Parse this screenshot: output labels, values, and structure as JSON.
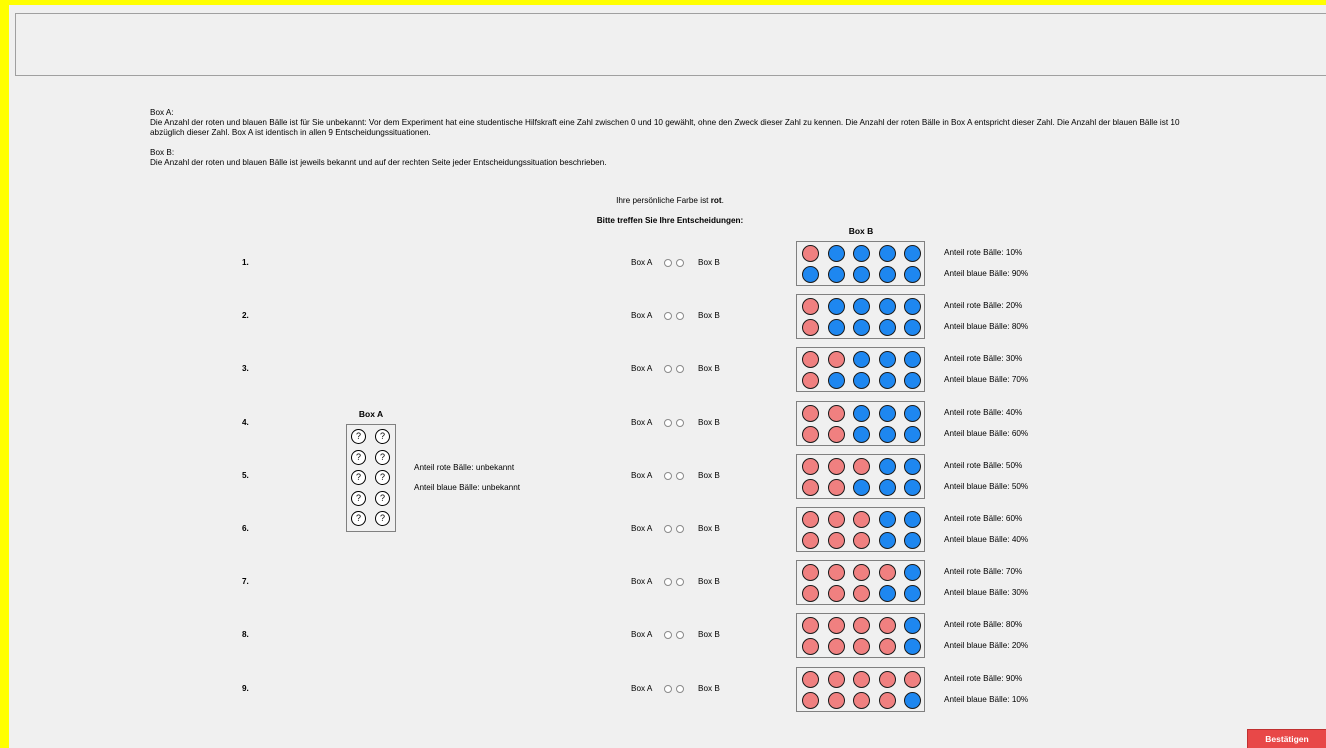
{
  "instructions": {
    "box_a_title": "Box A:",
    "box_a_text": "Die Anzahl der roten und blauen Bälle ist für Sie unbekannt: Vor dem Experiment hat eine studentische Hilfskraft eine Zahl zwischen 0 und 10 gewählt, ohne den Zweck dieser Zahl zu kennen. Die Anzahl der roten Bälle in Box A entspricht dieser Zahl. Die Anzahl der blauen Bälle ist 10 abzüglich dieser Zahl. Box A ist identisch in allen 9 Entscheidungssituationen.",
    "box_b_title": "Box B:",
    "box_b_text": "Die Anzahl der roten und blauen Bälle ist jeweils bekannt und auf der rechten Seite jeder Entscheidungssituation beschrieben."
  },
  "personal_color": {
    "prefix": "Ihre persönliche Farbe ist ",
    "color": "rot",
    "suffix": "."
  },
  "decision_heading": "Bitte treffen Sie Ihre Entscheidungen:",
  "box_a": {
    "heading": "Box A",
    "ball_symbol": "?",
    "red_share_text": "Anteil rote Bälle: unbekannt",
    "blue_share_text": "Anteil blaue Bälle: unbekannt"
  },
  "box_b_heading": "Box B",
  "choice_labels": {
    "a": "Box A",
    "b": "Box B"
  },
  "colors": {
    "red_ball": "#f08080",
    "blue_ball": "#1e87f0",
    "confirm": "#e84848",
    "frame": "#ffff00"
  },
  "decisions": [
    {
      "num": "1.",
      "red_balls": 1,
      "red_text": "Anteil rote Bälle: 10%",
      "blue_text": "Anteil blaue Bälle: 90%"
    },
    {
      "num": "2.",
      "red_balls": 2,
      "red_text": "Anteil rote Bälle: 20%",
      "blue_text": "Anteil blaue Bälle: 80%"
    },
    {
      "num": "3.",
      "red_balls": 3,
      "red_text": "Anteil rote Bälle: 30%",
      "blue_text": "Anteil blaue Bälle: 70%"
    },
    {
      "num": "4.",
      "red_balls": 4,
      "red_text": "Anteil rote Bälle: 40%",
      "blue_text": "Anteil blaue Bälle: 60%"
    },
    {
      "num": "5.",
      "red_balls": 5,
      "red_text": "Anteil rote Bälle: 50%",
      "blue_text": "Anteil blaue Bälle: 50%"
    },
    {
      "num": "6.",
      "red_balls": 6,
      "red_text": "Anteil rote Bälle: 60%",
      "blue_text": "Anteil blaue Bälle: 40%"
    },
    {
      "num": "7.",
      "red_balls": 7,
      "red_text": "Anteil rote Bälle: 70%",
      "blue_text": "Anteil blaue Bälle: 30%"
    },
    {
      "num": "8.",
      "red_balls": 8,
      "red_text": "Anteil rote Bälle: 80%",
      "blue_text": "Anteil blaue Bälle: 20%"
    },
    {
      "num": "9.",
      "red_balls": 9,
      "red_text": "Anteil rote Bälle: 90%",
      "blue_text": "Anteil blaue Bälle: 10%"
    }
  ],
  "confirm_label": "Bestätigen"
}
